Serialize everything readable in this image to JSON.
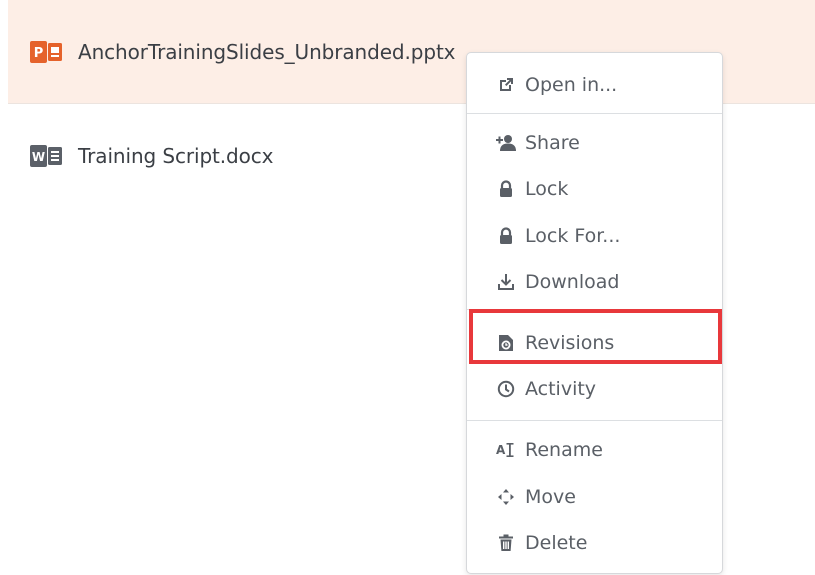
{
  "files": [
    {
      "name": "AnchorTrainingSlides_Unbranded.pptx",
      "type": "powerpoint",
      "icon": "powerpoint-icon",
      "selected": true
    },
    {
      "name": "Training Script.docx",
      "type": "word",
      "icon": "word-icon",
      "selected": false
    }
  ],
  "menu": {
    "items": [
      {
        "label": "Open in...",
        "icon": "open-external-icon"
      },
      {
        "label": "Share",
        "icon": "add-user-icon"
      },
      {
        "label": "Lock",
        "icon": "lock-icon"
      },
      {
        "label": "Lock For...",
        "icon": "lock-icon"
      },
      {
        "label": "Download",
        "icon": "download-icon"
      },
      {
        "label": "Revisions",
        "icon": "revisions-icon"
      },
      {
        "label": "Activity",
        "icon": "clock-icon"
      },
      {
        "label": "Rename",
        "icon": "rename-icon"
      },
      {
        "label": "Move",
        "icon": "move-icon"
      },
      {
        "label": "Delete",
        "icon": "trash-icon"
      }
    ]
  },
  "colors": {
    "selected_row_bg": "#fdeee6",
    "highlight_border": "#e8383b",
    "powerpoint": "#e5622b",
    "word": "#5b6068",
    "menu_text": "#5a5f66"
  }
}
